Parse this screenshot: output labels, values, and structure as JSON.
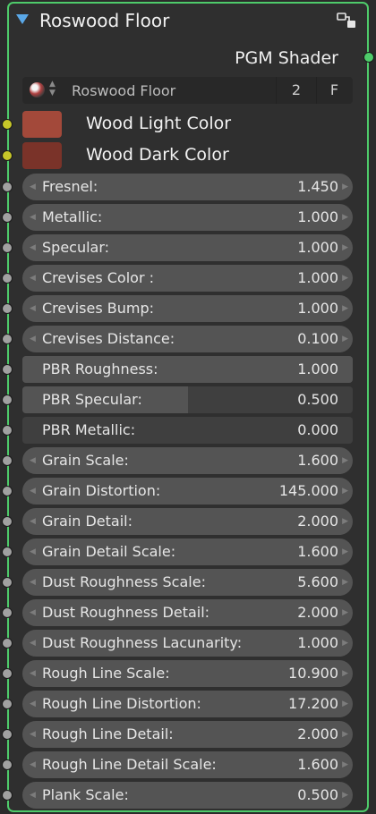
{
  "node": {
    "title": "Roswood Floor",
    "output_label": "PGM Shader",
    "header_icon": "node-group-icon",
    "accent_color": "#4ecb6a"
  },
  "material": {
    "name": "Roswood Floor",
    "users": "2",
    "fake_user": "F",
    "icon": "material-ball-icon"
  },
  "colors": [
    {
      "label": "Wood Light Color",
      "swatch": "#a3493a"
    },
    {
      "label": "Wood Dark Color",
      "swatch": "#7a3329"
    }
  ],
  "params": [
    {
      "label": "Fresnel:",
      "value": "1.450",
      "kind": "number"
    },
    {
      "label": "Metallic:",
      "value": "1.000",
      "kind": "number"
    },
    {
      "label": "Specular:",
      "value": "1.000",
      "kind": "number"
    },
    {
      "label": "Crevises Color :",
      "value": "1.000",
      "kind": "number"
    },
    {
      "label": "Crevises Bump:",
      "value": "1.000",
      "kind": "number"
    },
    {
      "label": "Crevises Distance:",
      "value": "0.100",
      "kind": "number"
    },
    {
      "label": "PBR Roughness:",
      "value": "1.000",
      "kind": "factor",
      "fill": 1.0
    },
    {
      "label": "PBR Specular:",
      "value": "0.500",
      "kind": "factor",
      "fill": 0.5
    },
    {
      "label": "PBR Metallic:",
      "value": "0.000",
      "kind": "factor",
      "fill": 0.0
    },
    {
      "label": "Grain Scale:",
      "value": "1.600",
      "kind": "number"
    },
    {
      "label": "Grain Distortion:",
      "value": "145.000",
      "kind": "number"
    },
    {
      "label": "Grain Detail:",
      "value": "2.000",
      "kind": "number"
    },
    {
      "label": "Grain Detail Scale:",
      "value": "1.600",
      "kind": "number"
    },
    {
      "label": "Dust Roughness Scale:",
      "value": "5.600",
      "kind": "number"
    },
    {
      "label": "Dust Roughness Detail:",
      "value": "2.000",
      "kind": "number"
    },
    {
      "label": "Dust Roughness Lacunarity:",
      "value": "1.000",
      "kind": "number"
    },
    {
      "label": "Rough Line Scale:",
      "value": "10.900",
      "kind": "number"
    },
    {
      "label": "Rough Line Distortion:",
      "value": "17.200",
      "kind": "number"
    },
    {
      "label": "Rough Line Detail:",
      "value": "2.000",
      "kind": "number"
    },
    {
      "label": "Rough Line Detail Scale:",
      "value": "1.600",
      "kind": "number"
    },
    {
      "label": "Plank Scale:",
      "value": "0.500",
      "kind": "number"
    }
  ]
}
